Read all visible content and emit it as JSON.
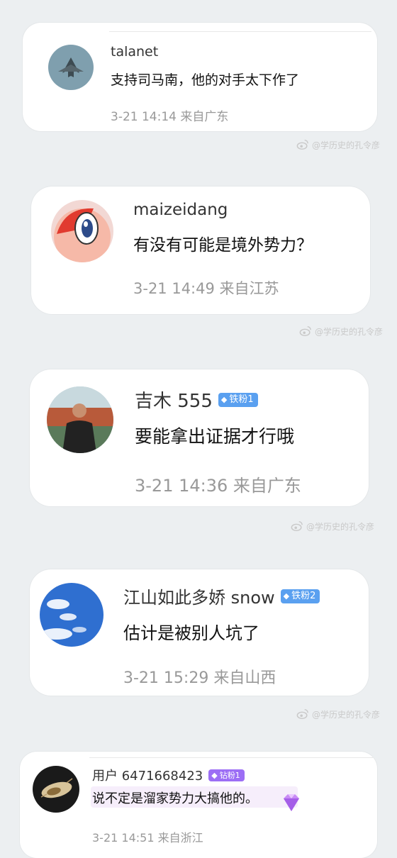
{
  "comments": [
    {
      "username": "talanet",
      "badge": null,
      "text": "支持司马南，他的对手太下作了",
      "time": "3-21 14:14",
      "location": "来自广东",
      "avatar_icon": "fighter-jet-avatar"
    },
    {
      "username": "maizeidang",
      "badge": null,
      "text": "有没有可能是境外势力？",
      "time": "3-21 14:49",
      "location": "来自江苏",
      "avatar_icon": "cartoon-mascot-avatar"
    },
    {
      "username": "吉木 555",
      "badge": "铁粉1",
      "text": "要能拿出证据才行哦",
      "time": "3-21 14:36",
      "location": "来自广东",
      "avatar_icon": "man-photo-avatar"
    },
    {
      "username": "江山如此多娇 snow",
      "badge": "铁粉2",
      "text": "估计是被别人坑了",
      "time": "3-21 15:29",
      "location": "来自山西",
      "avatar_icon": "blue-sky-avatar"
    },
    {
      "username": "用户 6471668423",
      "badge": "钻粉1",
      "text": "说不定是溜家势力大搞他的。",
      "time": "3-21 14:51",
      "location": "来自浙江",
      "avatar_icon": "cicada-avatar"
    }
  ],
  "watermark": "@学历史的孔令彦",
  "colors": {
    "iron_badge": "#5aa0f0",
    "diamond_badge": "#9c6ef5",
    "meta_text": "#999999",
    "watermark": "#c9c9c9"
  }
}
